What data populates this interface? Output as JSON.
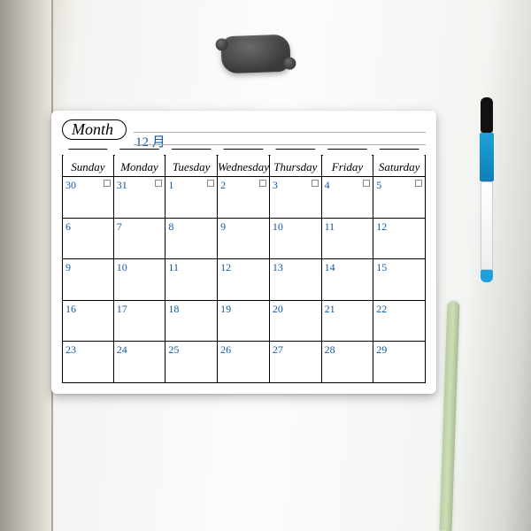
{
  "header": {
    "label": "Month",
    "value": "12 月"
  },
  "days": [
    "Sunday",
    "Monday",
    "Tuesday",
    "Wednesday",
    "Thursday",
    "Friday",
    "Saturday"
  ],
  "numbers": [
    "30",
    "31",
    "1",
    "2",
    "3",
    "4",
    "5",
    "6",
    "7",
    "8",
    "9",
    "10",
    "11",
    "12",
    "9",
    "10",
    "11",
    "12",
    "13",
    "14",
    "15",
    "16",
    "17",
    "18",
    "19",
    "20",
    "21",
    "22",
    "23",
    "24",
    "25",
    "26",
    "27",
    "28",
    "29"
  ],
  "checkbox_row": 0
}
